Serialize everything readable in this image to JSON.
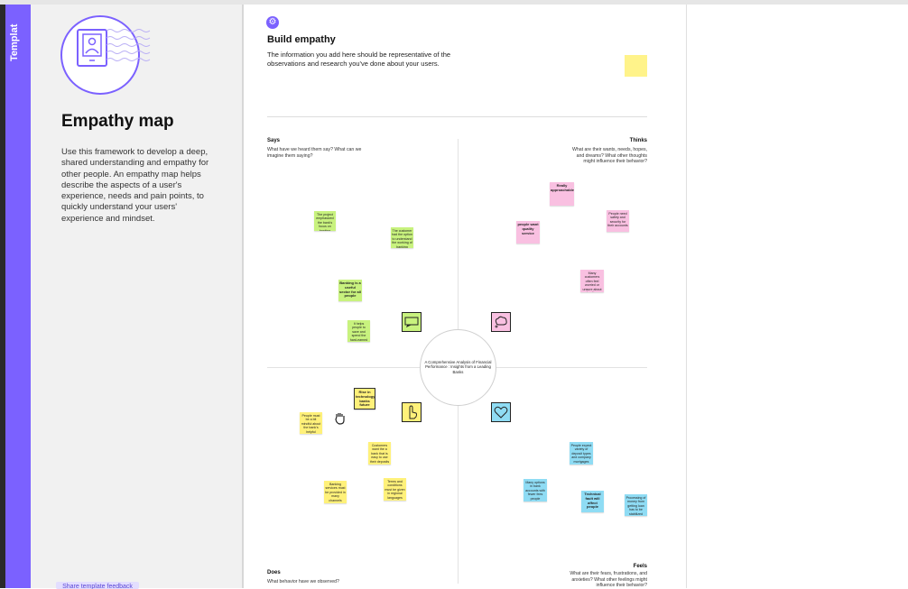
{
  "sidebar": {
    "label": "Templat"
  },
  "template_panel": {
    "title": "Empathy map",
    "description": "Use this framework to develop a deep, shared understanding and empathy for other people. An empathy map helps describe the aspects of a user's experience, needs and pain points, to quickly understand your users' experience and mindset.",
    "feedback_label": "Share template feedback"
  },
  "board": {
    "title": "Build empathy",
    "description": "The information you add here should be representative of the observations and research you've done about your users.",
    "center_text": "A Comprehensive Analysis of Financial Performance : Insights from a Leading Banks",
    "quadrants": {
      "says": {
        "title": "Says",
        "prompt": "What have we heard them say? What can we imagine them saying?"
      },
      "thinks": {
        "title": "Thinks",
        "prompt": "What are their wants, needs, hopes, and dreams? What other thoughts might influence their behavior?"
      },
      "does": {
        "title": "Does",
        "prompt": "What behavior have we observed?"
      },
      "feels": {
        "title": "Feels",
        "prompt": "What are their fears, frustrations, and anxieties? What other feelings might influence their behavior?"
      }
    },
    "stickies": {
      "g1": "The project emphasized the bank's focus on banking clients",
      "g2": "The customer had the option to understand the working of banking issues",
      "g3": "Banking is a useful sector for all people",
      "g4": "It helps people to save and spend the hard-earned money",
      "p1": "Really approachable",
      "p2": "people want quality service",
      "p3": "People need safety and security for their accounts",
      "p4": "Many customers often feel worried or unsure about banking services",
      "y1": "Rise in technology banks future",
      "y2": "People must be a bit mindful about the bank's helpful information on bank",
      "y3": "Customers want the a bank that is easy to use their deposits",
      "y4": "Banking services must be provided in many channels",
      "y5": "Terms and conditions must be given in regional languages",
      "b1": "People expect variety of deposit types and company mortgages",
      "b2": "Many options in bank accounts with fewer fees people",
      "b3": "Technical fault will affect people",
      "b4": "Processing of money from getting loan has to be stabilized"
    }
  }
}
